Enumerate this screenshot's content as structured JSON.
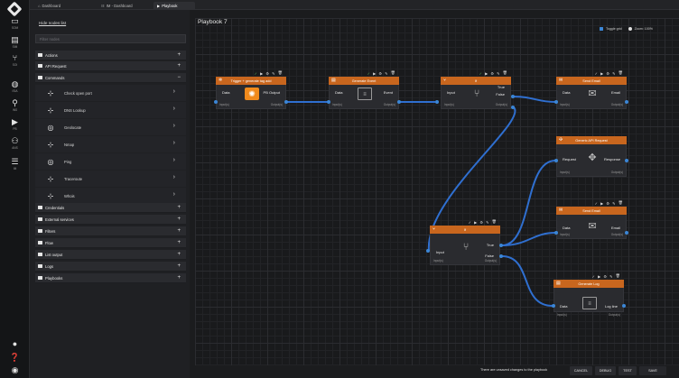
{
  "tabs": [
    {
      "icon": "home-icon",
      "label": "Dashboard"
    },
    {
      "icon": "grid-icon",
      "label": "IM - Dashboard"
    },
    {
      "icon": "play-icon",
      "label": "Playbook"
    }
  ],
  "iconbar": [
    {
      "icon": "monitor-icon",
      "label": "SOM"
    },
    {
      "icon": "layers-icon",
      "label": "SIM"
    },
    {
      "icon": "branch-icon",
      "label": "SOI"
    },
    {
      "icon": "shield-icon",
      "label": "ISIA"
    },
    {
      "icon": "search-icon",
      "label": "INS"
    },
    {
      "icon": "play-icon",
      "label": "PB"
    },
    {
      "icon": "users-icon",
      "label": "ANS"
    },
    {
      "icon": "list-icon",
      "label": "IM"
    }
  ],
  "sidebar": {
    "hide_link": "Hide nodes list",
    "filter_placeholder": "Filter nodes",
    "categories_top": [
      {
        "label": "Actions",
        "toggle": "+"
      },
      {
        "label": "API Request",
        "toggle": "+"
      },
      {
        "label": "Commands",
        "toggle": "−"
      }
    ],
    "commands": [
      {
        "icon": "network-icon",
        "label": "Check open port"
      },
      {
        "icon": "network-icon",
        "label": "DNS Lookup"
      },
      {
        "icon": "globe-icon",
        "label": "Geolocate"
      },
      {
        "icon": "network-icon",
        "label": "Nmap"
      },
      {
        "icon": "globe-icon",
        "label": "Ping"
      },
      {
        "icon": "network-icon",
        "label": "Traceroute"
      },
      {
        "icon": "network-icon",
        "label": "Whois"
      }
    ],
    "categories_bottom": [
      {
        "label": "Credentials",
        "toggle": "+"
      },
      {
        "label": "External services",
        "toggle": "+"
      },
      {
        "label": "Filters",
        "toggle": "+"
      },
      {
        "label": "Flow",
        "toggle": "+"
      },
      {
        "label": "List output",
        "toggle": "+"
      },
      {
        "label": "Logs",
        "toggle": "+"
      },
      {
        "label": "Playbooks",
        "toggle": "+"
      }
    ]
  },
  "canvas": {
    "title": "Playbook 7",
    "toggle_grid": "Toggle grid",
    "zoom": "Zoom: 100%"
  },
  "nodes": {
    "trigger": {
      "title": "Trigger + generate tag add",
      "in": "Data",
      "out": "PB Output",
      "in_label": "Input(s)",
      "out_label": "Output(s)"
    },
    "gen_event": {
      "title": "Generate Event",
      "in": "Data",
      "out": "Event",
      "in_label": "Input(s)",
      "out_label": "Output(s)"
    },
    "if1": {
      "title": "If",
      "in": "Input",
      "out": "True",
      "out2": "False",
      "in_label": "Input(s)",
      "out_label": "Output(s)"
    },
    "send_email1": {
      "title": "Send Email",
      "in": "Data",
      "out": "Email",
      "in_label": "Input(s)",
      "out_label": "Output(s)"
    },
    "api": {
      "title": "Generic API Request",
      "in": "Request",
      "out": "Response",
      "in_label": "Input(s)",
      "out_label": "Output(s)"
    },
    "send_email2": {
      "title": "Send Email",
      "in": "Data",
      "out": "Email",
      "in_label": "Input(s)",
      "out_label": "Output(s)"
    },
    "if2": {
      "title": "If",
      "in": "Input",
      "out": "True",
      "out2": "False",
      "in_label": "Input(s)",
      "out_label": "Output(s)"
    },
    "gen_log": {
      "title": "Generate Log",
      "in": "Data",
      "out": "Log line",
      "in_label": "Input(s)",
      "out_label": "Output(s)"
    }
  },
  "footer": {
    "unsaved": "There are unsaved changes to the playbook",
    "cancel": "CANCEL",
    "debug": "DEBUG",
    "test": "TEST",
    "save": "SAVE"
  },
  "colors": {
    "accent": "#3b86d6",
    "node_header": "#c8661e"
  }
}
